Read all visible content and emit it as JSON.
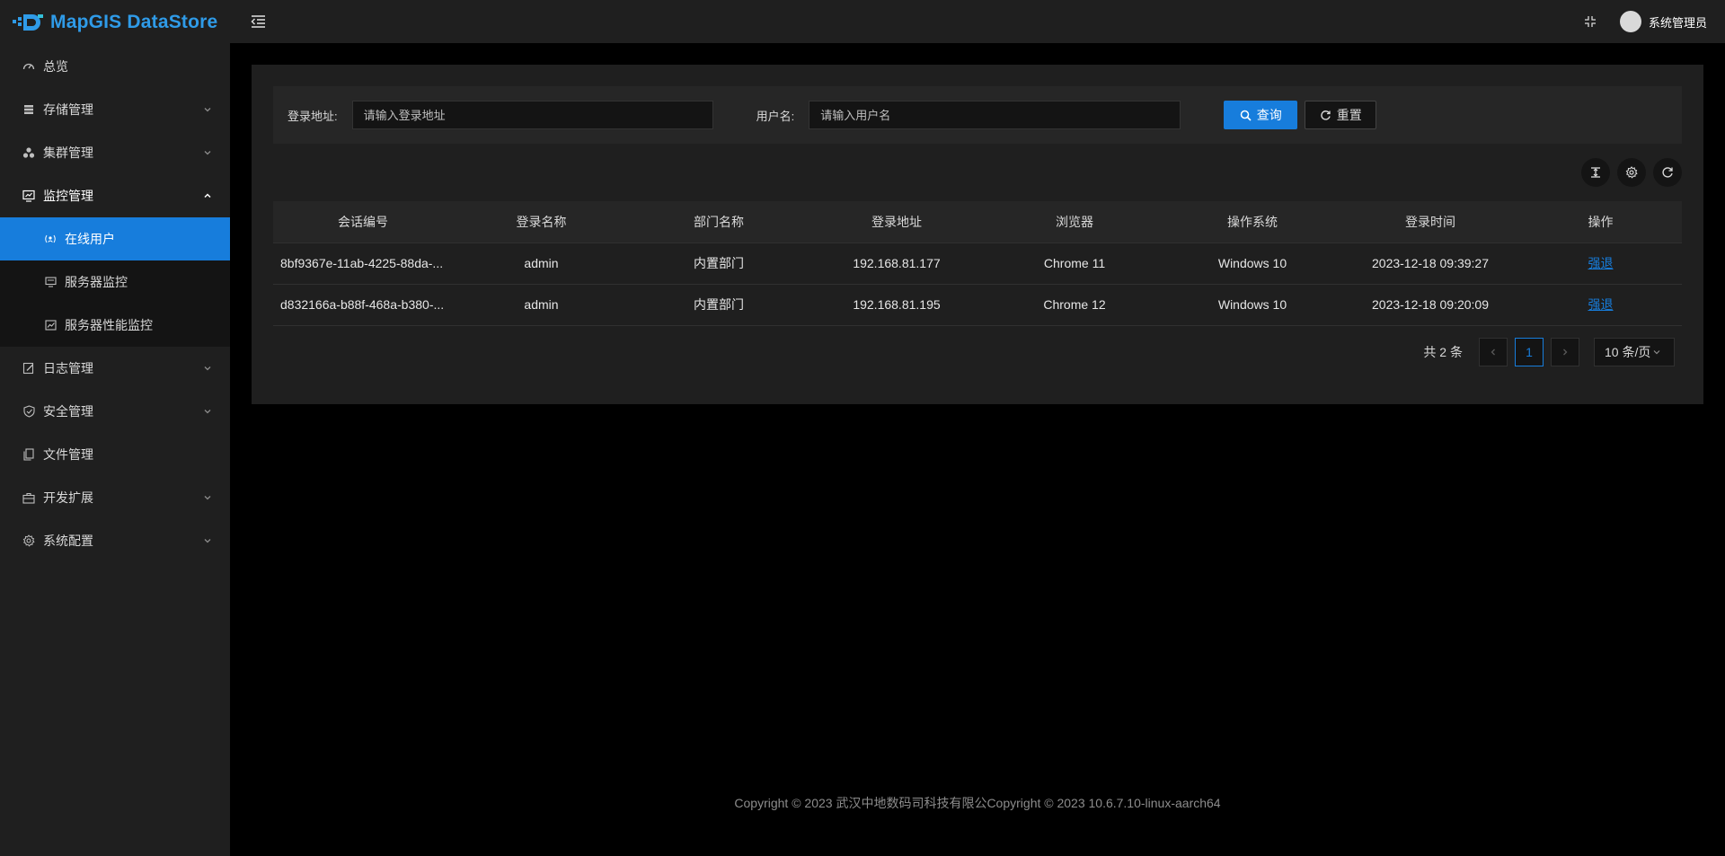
{
  "app": {
    "title": "MapGIS DataStore"
  },
  "sidebar": {
    "items": [
      {
        "label": "总览",
        "icon": "dashboard-icon"
      },
      {
        "label": "存储管理",
        "icon": "database-icon"
      },
      {
        "label": "集群管理",
        "icon": "cluster-icon"
      },
      {
        "label": "监控管理",
        "icon": "monitor-icon"
      },
      {
        "label": "日志管理",
        "icon": "edit-icon"
      },
      {
        "label": "安全管理",
        "icon": "shield-icon"
      },
      {
        "label": "文件管理",
        "icon": "file-copy-icon"
      },
      {
        "label": "开发扩展",
        "icon": "toolbox-icon"
      },
      {
        "label": "系统配置",
        "icon": "gear-icon"
      }
    ],
    "monitor_sub": [
      {
        "label": "在线用户",
        "icon": "online-user-icon"
      },
      {
        "label": "服务器监控",
        "icon": "server-icon"
      },
      {
        "label": "服务器性能监控",
        "icon": "line-chart-icon"
      }
    ]
  },
  "header": {
    "username": "系统管理员"
  },
  "search": {
    "addr_label": "登录地址:",
    "addr_placeholder": "请输入登录地址",
    "user_label": "用户名:",
    "user_placeholder": "请输入用户名",
    "query_label": "查询",
    "reset_label": "重置"
  },
  "table": {
    "columns": [
      "会话编号",
      "登录名称",
      "部门名称",
      "登录地址",
      "浏览器",
      "操作系统",
      "登录时间",
      "操作"
    ],
    "rows": [
      [
        "8bf9367e-11ab-4225-88da-...",
        "admin",
        "内置部门",
        "192.168.81.177",
        "Chrome 11",
        "Windows 10",
        "2023-12-18 09:39:27",
        "强退"
      ],
      [
        "d832166a-b88f-468a-b380-...",
        "admin",
        "内置部门",
        "192.168.81.195",
        "Chrome 12",
        "Windows 10",
        "2023-12-18 09:20:09",
        "强退"
      ]
    ]
  },
  "pagination": {
    "total": "共 2 条",
    "current": "1",
    "page_size": "10 条/页"
  },
  "footer": {
    "text": "Copyright © 2023 武汉中地数码司科技有限公Copyright © 2023 10.6.7.10-linux-aarch64"
  },
  "colors": {
    "accent": "#177ddc",
    "sidebar_bg": "#1f1f1f",
    "body_bg": "#000000"
  }
}
